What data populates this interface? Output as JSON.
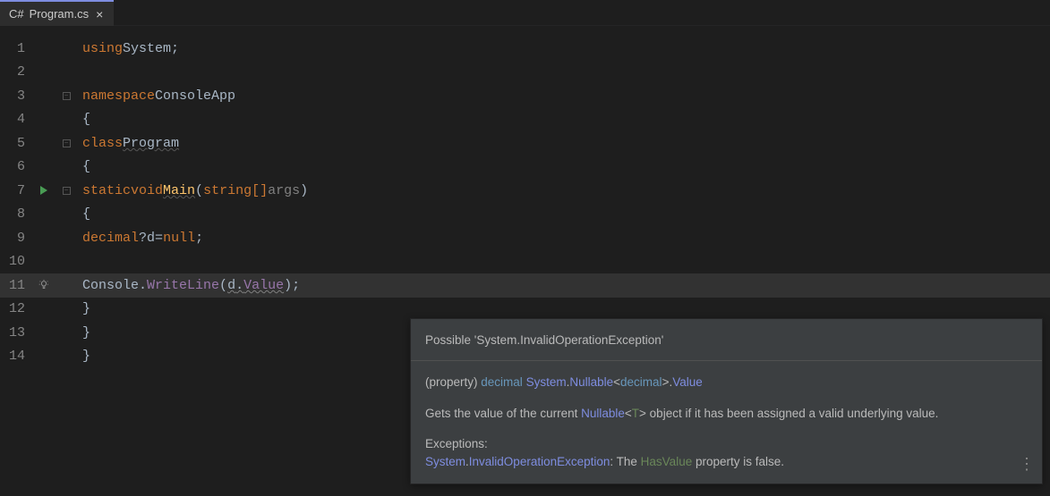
{
  "tab": {
    "language": "C#",
    "filename": "Program.cs",
    "close": "×"
  },
  "lines": {
    "numbers": [
      "1",
      "2",
      "3",
      "4",
      "5",
      "6",
      "7",
      "8",
      "9",
      "10",
      "11",
      "12",
      "13",
      "14"
    ]
  },
  "code": {
    "l1": {
      "using": "using",
      "ns": "System",
      "semi": ";"
    },
    "l3": {
      "namespace": "namespace",
      "name": "ConsoleApp"
    },
    "l4": {
      "brace": "{"
    },
    "l5": {
      "class": "class",
      "name": "Program"
    },
    "l6": {
      "brace": "{"
    },
    "l7": {
      "static": "static",
      "void": "void",
      "name": "Main",
      "lparen": "(",
      "ptype": "string[]",
      "pname": "args",
      "rparen": ")"
    },
    "l8": {
      "brace": "{"
    },
    "l9": {
      "type": "decimal",
      "q": "?",
      "var": "d",
      "eq": "=",
      "null": "null",
      "semi": ";"
    },
    "l11": {
      "console": "Console",
      "dot1": ".",
      "write": "WriteLine",
      "lparen": "(",
      "var": "d",
      "dot2": ".",
      "value": "Value",
      "rparen": ")",
      "semi": ";"
    },
    "l12": {
      "brace": "}"
    },
    "l13": {
      "brace": "}"
    },
    "l14": {
      "brace": "}"
    }
  },
  "tooltip": {
    "header": "Possible 'System.InvalidOperationException'",
    "sig_prefix": "(property) ",
    "sig_type1": "decimal",
    "sig_space": " ",
    "sig_ns": "System",
    "sig_dot1": ".",
    "sig_nullable": "Nullable",
    "sig_lt": "<",
    "sig_type2": "decimal",
    "sig_gt": ">",
    "sig_dot2": ".",
    "sig_value": "Value",
    "desc_1": "Gets the value of the current ",
    "desc_nullable": "Nullable",
    "desc_lt": "<",
    "desc_t": "T",
    "desc_gt": ">",
    "desc_2": " object if it has been assigned a valid underlying value.",
    "exc_heading": "Exceptions:",
    "exc_ns": "System",
    "exc_dot": ".",
    "exc_name": "InvalidOperationException",
    "exc_colon": ": The ",
    "exc_prop": "HasValue",
    "exc_tail": " property is false.",
    "actions": "⋮"
  }
}
